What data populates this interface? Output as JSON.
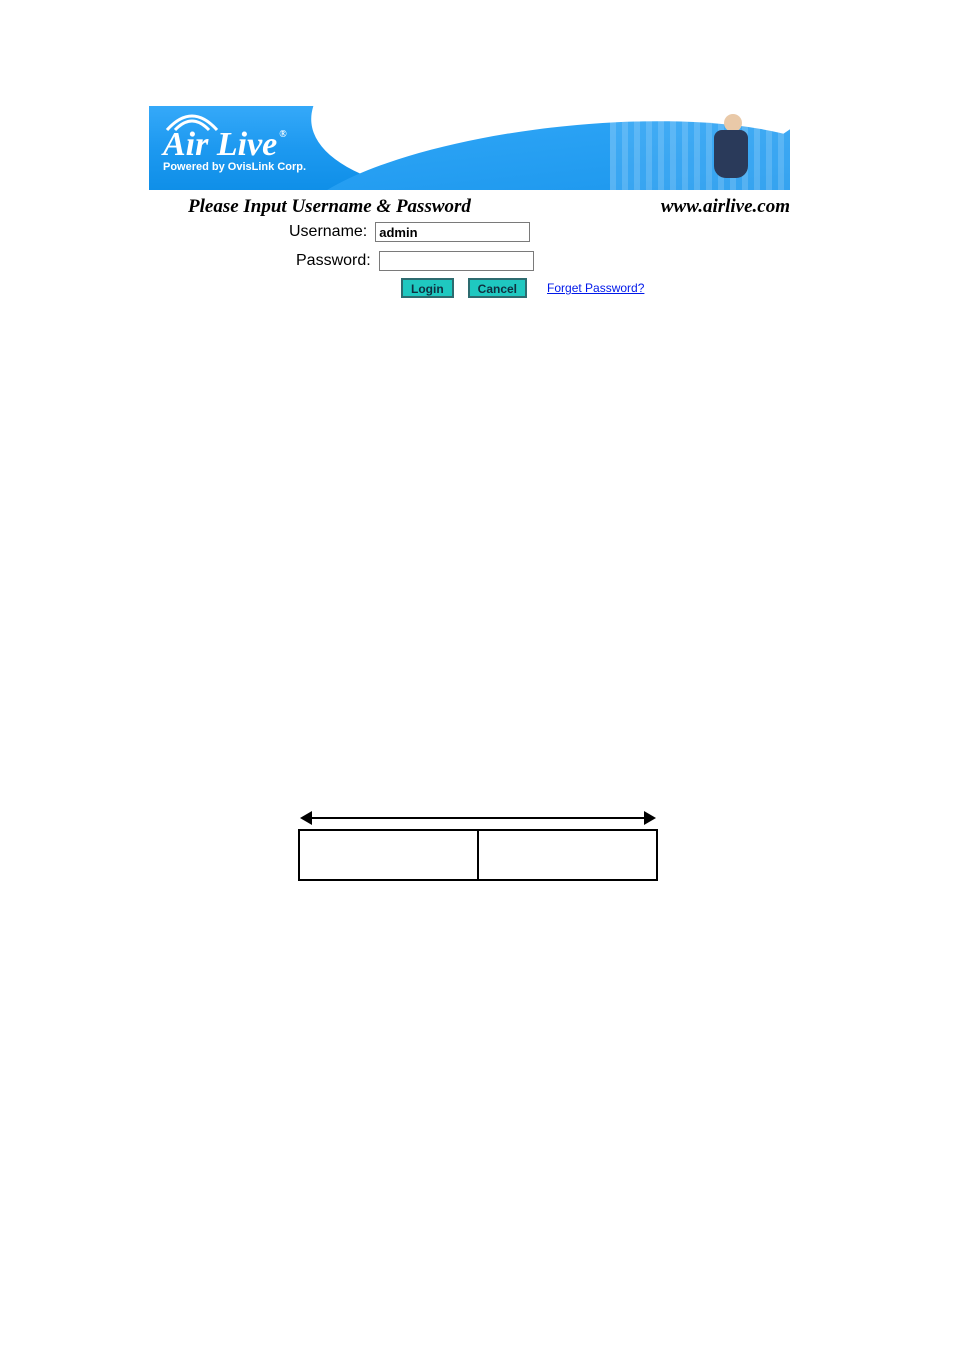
{
  "banner": {
    "brand_text": "Air Live",
    "brand_reg": "®",
    "tagline": "Powered by OvisLink Corp."
  },
  "headline": {
    "left": "Please Input Username & Password",
    "right": "www.airlive.com"
  },
  "form": {
    "username_label": "Username:",
    "username_value": "admin",
    "password_label": "Password:",
    "password_value": ""
  },
  "buttons": {
    "login": "Login",
    "cancel": "Cancel",
    "forgot": "Forget Password?"
  }
}
